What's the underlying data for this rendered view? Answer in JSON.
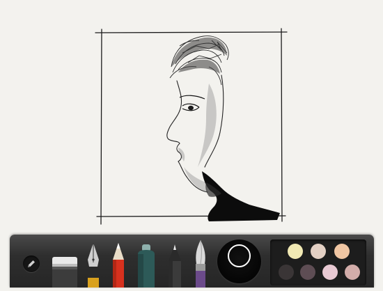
{
  "app": {
    "canvas_background": "#f3f2ee",
    "toolbar_background": "#2e2e2e"
  },
  "toolbar": {
    "edit_icon": "pencil-icon",
    "tools": [
      {
        "name": "eraser",
        "icon": "eraser-icon"
      },
      {
        "name": "fountain-pen",
        "icon": "fountain-pen-icon"
      },
      {
        "name": "pencil",
        "icon": "pencil-icon",
        "color": "#d7311e"
      },
      {
        "name": "marker",
        "icon": "marker-icon",
        "color": "#2d5a58"
      },
      {
        "name": "outline-pen",
        "icon": "outline-pen-icon"
      },
      {
        "name": "brush",
        "icon": "brush-icon",
        "color": "#6b4a8a"
      }
    ],
    "current_color": "#000000",
    "swatches": [
      "#f1e9b4",
      "#e3d0c4",
      "#f0c6a3",
      "#3a3536",
      "#5e4d54",
      "#e8c9d3",
      "#d3adaa"
    ]
  }
}
